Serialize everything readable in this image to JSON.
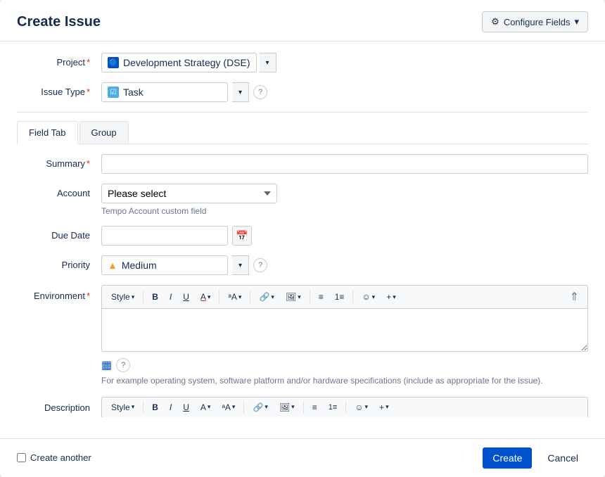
{
  "dialog": {
    "title": "Create Issue",
    "configure_btn": "Configure Fields"
  },
  "project": {
    "label": "Project",
    "value": "Development Strategy (DSE)",
    "icon": "🔵"
  },
  "issue_type": {
    "label": "Issue Type",
    "value": "Task"
  },
  "tabs": [
    {
      "id": "field-tab",
      "label": "Field Tab",
      "active": true
    },
    {
      "id": "group-tab",
      "label": "Group",
      "active": false
    }
  ],
  "summary": {
    "label": "Summary",
    "placeholder": "",
    "value": ""
  },
  "account": {
    "label": "Account",
    "placeholder": "Please select",
    "hint": "Tempo Account custom field"
  },
  "due_date": {
    "label": "Due Date",
    "placeholder": "",
    "value": ""
  },
  "priority": {
    "label": "Priority",
    "value": "Medium",
    "icon": "▲"
  },
  "environment": {
    "label": "Environment",
    "hint": "For example operating system, software platform and/or hardware specifications (include as appropriate for the issue).",
    "toolbar": {
      "style": "Style",
      "bold": "B",
      "italic": "I",
      "underline": "U",
      "text_color": "A",
      "font_size": "ᵃA"
    }
  },
  "description": {
    "label": "Description"
  },
  "footer": {
    "create_another": "Create another",
    "create_btn": "Create",
    "cancel_btn": "Cancel"
  }
}
